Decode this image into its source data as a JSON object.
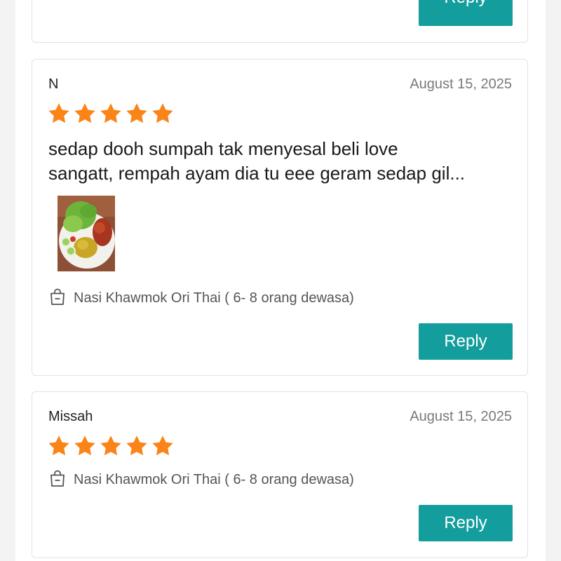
{
  "colors": {
    "accent": "#139d9c",
    "star": "#fb8419",
    "date_text": "#7a7a7a",
    "product_text": "#555555"
  },
  "previous_review": {
    "reply_label": "Reply"
  },
  "reviews": [
    {
      "author": "N",
      "date": "August 15, 2025",
      "rating": 5,
      "text_lines": [
        "sedap dooh sumpah tak menyesal beli love",
        "sangatt, rempah ayam dia tu eee geram sedap gil..."
      ],
      "photo_icon": "food-photo",
      "product_icon": "shopping-bag-icon",
      "product": "Nasi Khawmok Ori Thai ( 6- 8 orang dewasa)",
      "reply_label": "Reply"
    },
    {
      "author": "Missah",
      "date": "August 15, 2025",
      "rating": 5,
      "product_icon": "shopping-bag-icon",
      "product": "Nasi Khawmok Ori Thai ( 6- 8 orang dewasa)",
      "reply_label": "Reply"
    }
  ]
}
